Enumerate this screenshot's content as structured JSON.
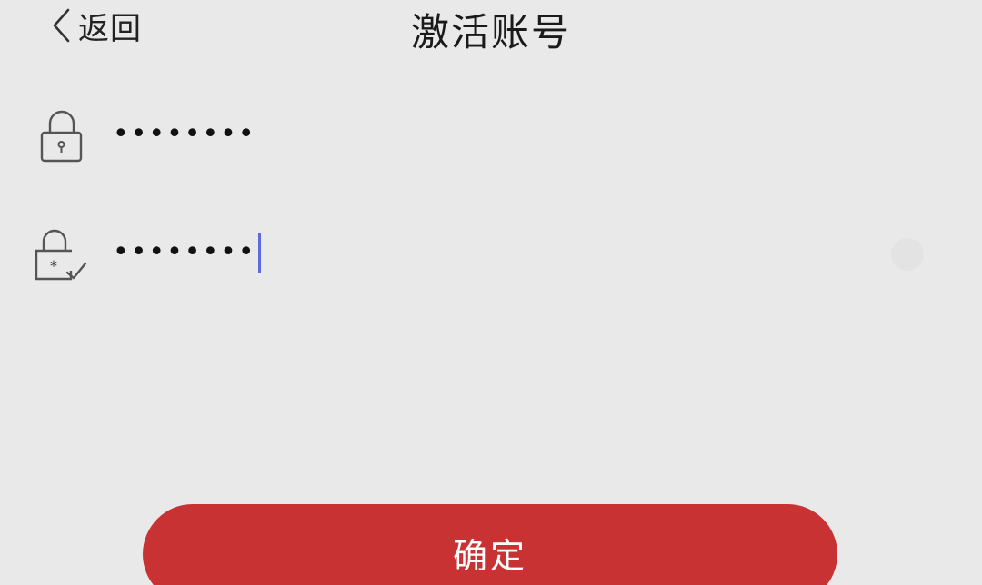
{
  "nav": {
    "back_label": "返回",
    "title": "激活账号"
  },
  "form": {
    "password": {
      "icon": "lock-icon",
      "masked_value": "••••••••"
    },
    "confirm_password": {
      "icon": "lock-check-icon",
      "masked_value": "••••••••",
      "clear_icon": "clear-icon"
    }
  },
  "actions": {
    "confirm_label": "确定"
  },
  "colors": {
    "background": "#e9e9e9",
    "primary": "#c93232",
    "caret": "#5d6ae0"
  }
}
